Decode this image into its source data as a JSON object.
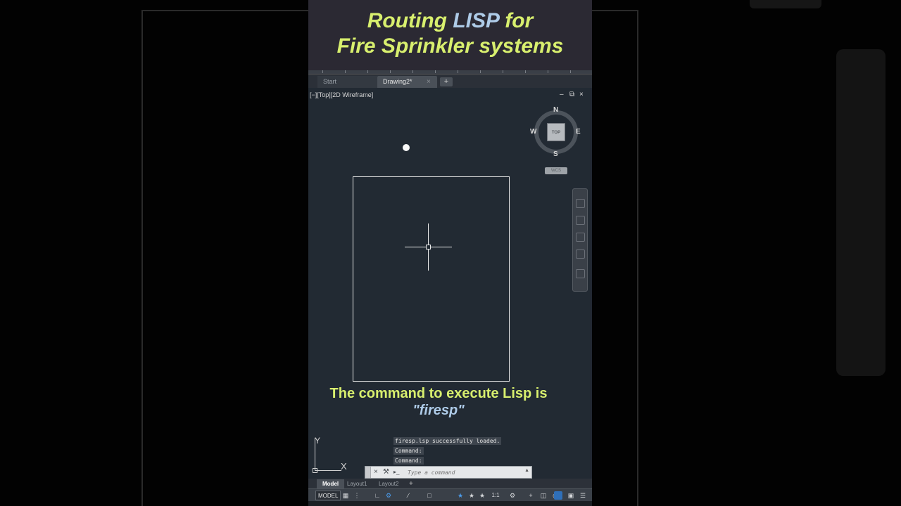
{
  "banner": {
    "line1_prefix": "Routing ",
    "line1_accent": "LISP",
    "line1_suffix": " for",
    "line2": "Fire Sprinkler systems"
  },
  "tabs": [
    {
      "label": "Start",
      "active": false
    },
    {
      "label": "Drawing2*",
      "active": true
    }
  ],
  "tab_close": "×",
  "tab_add": "+",
  "viewport": {
    "label": "[−][Top][2D Wireframe]",
    "controls": {
      "minimize": "–",
      "restore": "⧉",
      "close": "×"
    }
  },
  "viewcube": {
    "face": "TOP",
    "north": "N",
    "south": "S",
    "east": "E",
    "west": "W",
    "wcs": "WCS"
  },
  "ucs": {
    "x": "X",
    "y": "Y"
  },
  "caption": {
    "line1": "The command to execute Lisp is",
    "line2": "\"firesp\""
  },
  "command_history": [
    "firesp.lsp successfully loaded.",
    "Command:",
    "Command:"
  ],
  "command_line": {
    "placeholder": "Type a command",
    "close_icon": "×",
    "settings_icon": "⚒",
    "prompt_icon": "▸_"
  },
  "layout_tabs": [
    {
      "label": "Model",
      "active": true
    },
    {
      "label": "Layout1",
      "active": false
    },
    {
      "label": "Layout2",
      "active": false
    }
  ],
  "layout_add": "+",
  "status": {
    "model": "MODEL",
    "scale": "1:1",
    "icons": [
      "grid-icon",
      "snap-icon",
      "ortho-icon",
      "polar-icon",
      "isodraft-icon",
      "osnap-icon",
      "annotation-icon",
      "workspace-icon",
      "plus-icon",
      "units-icon",
      "isolate-icon",
      "hardware-accel-icon",
      "clean-screen-icon",
      "customize-icon"
    ]
  },
  "colors": {
    "title_yellow": "#d8ef6e",
    "title_blue": "#aecbe8",
    "viewport_bg": "#222a33"
  }
}
